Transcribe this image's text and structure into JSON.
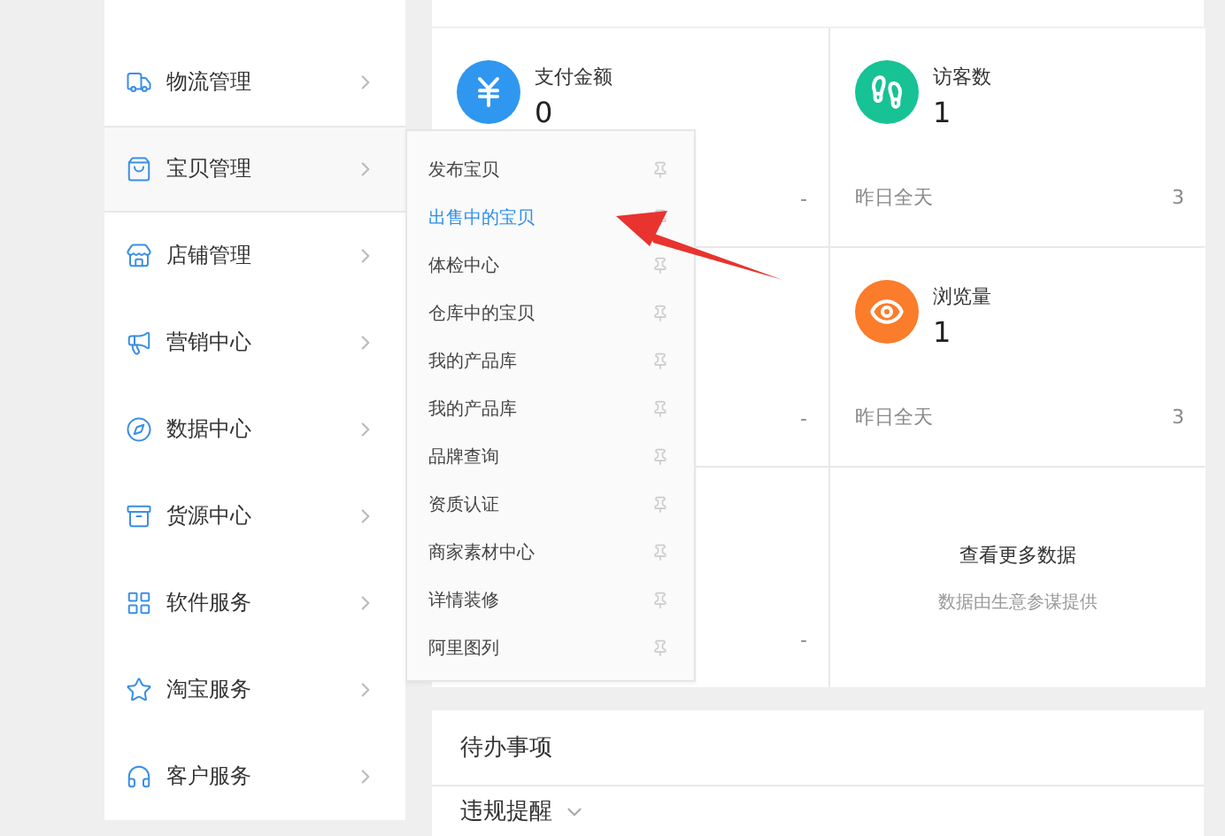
{
  "sidebar": {
    "items": [
      {
        "label": "物流管理",
        "selected": false
      },
      {
        "label": "宝贝管理",
        "selected": true
      },
      {
        "label": "店铺管理",
        "selected": false
      },
      {
        "label": "营销中心",
        "selected": false
      },
      {
        "label": "数据中心",
        "selected": false
      },
      {
        "label": "货源中心",
        "selected": false
      },
      {
        "label": "软件服务",
        "selected": false
      },
      {
        "label": "淘宝服务",
        "selected": false
      },
      {
        "label": "客户服务",
        "selected": false
      }
    ]
  },
  "submenu": {
    "items": [
      {
        "label": "发布宝贝",
        "selected": false
      },
      {
        "label": "出售中的宝贝",
        "selected": true
      },
      {
        "label": "体检中心",
        "selected": false
      },
      {
        "label": "仓库中的宝贝",
        "selected": false
      },
      {
        "label": "我的产品库",
        "selected": false
      },
      {
        "label": "我的产品库",
        "selected": false
      },
      {
        "label": "品牌查询",
        "selected": false
      },
      {
        "label": "资质认证",
        "selected": false
      },
      {
        "label": "商家素材中心",
        "selected": false
      },
      {
        "label": "详情装修",
        "selected": false
      },
      {
        "label": "阿里图列",
        "selected": false
      }
    ]
  },
  "stats": [
    {
      "kind": "metric",
      "color": "#2f97f0",
      "title": "支付金额",
      "value": "0",
      "footer_value": "-"
    },
    {
      "kind": "metric",
      "color": "#17c295",
      "title": "访客数",
      "value": "1",
      "footer": "昨日全天",
      "footer_value": "3"
    },
    {
      "kind": "covered",
      "footer_value": "-"
    },
    {
      "kind": "metric",
      "color": "#fb7c2a",
      "title": "浏览量",
      "value": "1",
      "footer": "昨日全天",
      "footer_value": "3"
    },
    {
      "kind": "covered",
      "footer_value": "-"
    },
    {
      "kind": "more",
      "title": "查看更多数据",
      "subtitle": "数据由生意参谋提供"
    }
  ],
  "todo": {
    "title": "待办事项",
    "section": "违规提醒"
  }
}
